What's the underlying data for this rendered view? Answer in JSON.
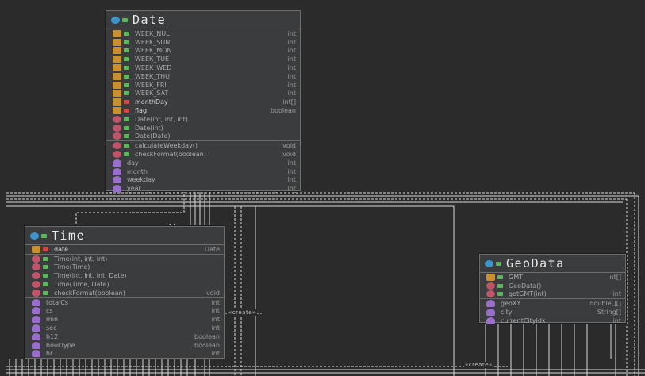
{
  "classes": {
    "date": {
      "title": "Date",
      "members": [
        {
          "kind": "field",
          "vis": "pub",
          "name": "WEEK_NUL",
          "type": "int"
        },
        {
          "kind": "field",
          "vis": "pub",
          "name": "WEEK_SUN",
          "type": "int"
        },
        {
          "kind": "field",
          "vis": "pub",
          "name": "WEEK_MON",
          "type": "int"
        },
        {
          "kind": "field",
          "vis": "pub",
          "name": "WEEK_TUE",
          "type": "int"
        },
        {
          "kind": "field",
          "vis": "pub",
          "name": "WEEK_WED",
          "type": "int"
        },
        {
          "kind": "field",
          "vis": "pub",
          "name": "WEEK_THU",
          "type": "int"
        },
        {
          "kind": "field",
          "vis": "pub",
          "name": "WEEK_FRI",
          "type": "int"
        },
        {
          "kind": "field",
          "vis": "pub",
          "name": "WEEK_SAT",
          "type": "int"
        },
        {
          "kind": "field",
          "vis": "priv",
          "name": "monthDay",
          "type": "int[]"
        },
        {
          "kind": "field",
          "vis": "priv",
          "name": "flag",
          "type": "boolean"
        },
        {
          "kind": "method",
          "vis": "pub",
          "name": "Date(int, int, int)",
          "type": ""
        },
        {
          "kind": "method",
          "vis": "pub",
          "name": "Date(int)",
          "type": ""
        },
        {
          "kind": "method",
          "vis": "pub",
          "name": "Date(Date)",
          "type": "",
          "sep_after": true
        },
        {
          "kind": "method",
          "vis": "pub",
          "name": "calculateWeekday()",
          "type": "void"
        },
        {
          "kind": "method",
          "vis": "pub",
          "name": "checkFormat(boolean)",
          "type": "void"
        },
        {
          "kind": "prop",
          "vis": "",
          "name": "day",
          "type": "int"
        },
        {
          "kind": "prop",
          "vis": "",
          "name": "month",
          "type": "int"
        },
        {
          "kind": "prop",
          "vis": "",
          "name": "weekday",
          "type": "int"
        },
        {
          "kind": "prop",
          "vis": "",
          "name": "year",
          "type": "int"
        }
      ]
    },
    "time": {
      "title": "Time",
      "members": [
        {
          "kind": "field",
          "vis": "priv",
          "name": "date",
          "type": "Date",
          "sep_after": true
        },
        {
          "kind": "method",
          "vis": "pub",
          "name": "Time(int, int, int)",
          "type": ""
        },
        {
          "kind": "method",
          "vis": "pub",
          "name": "Time(Time)",
          "type": ""
        },
        {
          "kind": "method",
          "vis": "pub",
          "name": "Time(int, int, int, Date)",
          "type": ""
        },
        {
          "kind": "method",
          "vis": "pub",
          "name": "Time(Time, Date)",
          "type": ""
        },
        {
          "kind": "method",
          "vis": "pub",
          "name": "checkFormat(boolean)",
          "type": "void",
          "sep_after": true
        },
        {
          "kind": "prop",
          "vis": "",
          "name": "totalCs",
          "type": "int"
        },
        {
          "kind": "prop",
          "vis": "",
          "name": "cs",
          "type": "int"
        },
        {
          "kind": "prop",
          "vis": "",
          "name": "min",
          "type": "int"
        },
        {
          "kind": "prop",
          "vis": "",
          "name": "sec",
          "type": "int"
        },
        {
          "kind": "prop",
          "vis": "",
          "name": "h12",
          "type": "boolean"
        },
        {
          "kind": "prop",
          "vis": "",
          "name": "hourType",
          "type": "boolean"
        },
        {
          "kind": "prop",
          "vis": "",
          "name": "hr",
          "type": "int"
        }
      ]
    },
    "geodata": {
      "title": "GeoData",
      "members": [
        {
          "kind": "field",
          "vis": "pub",
          "name": "GMT",
          "type": "int[]"
        },
        {
          "kind": "method",
          "vis": "pub",
          "name": "GeoData()",
          "type": ""
        },
        {
          "kind": "method",
          "vis": "pub",
          "name": "getGMT(int)",
          "type": "int",
          "sep_after": true
        },
        {
          "kind": "prop",
          "vis": "",
          "name": "geoXY",
          "type": "double[][]"
        },
        {
          "kind": "prop",
          "vis": "",
          "name": "city",
          "type": "String[]"
        },
        {
          "kind": "prop",
          "vis": "",
          "name": "currentCityIdx",
          "type": "int"
        }
      ]
    }
  },
  "relations": {
    "create_label": "«create»"
  },
  "colors": {
    "background": "#2b2b2b",
    "class_badge": "#3e95c9",
    "field_badge": "#c8902e",
    "method_badge": "#c0556a",
    "property_badge": "#9a6fcc",
    "public_marker": "#5fb45f",
    "private_marker": "#d0464b"
  }
}
